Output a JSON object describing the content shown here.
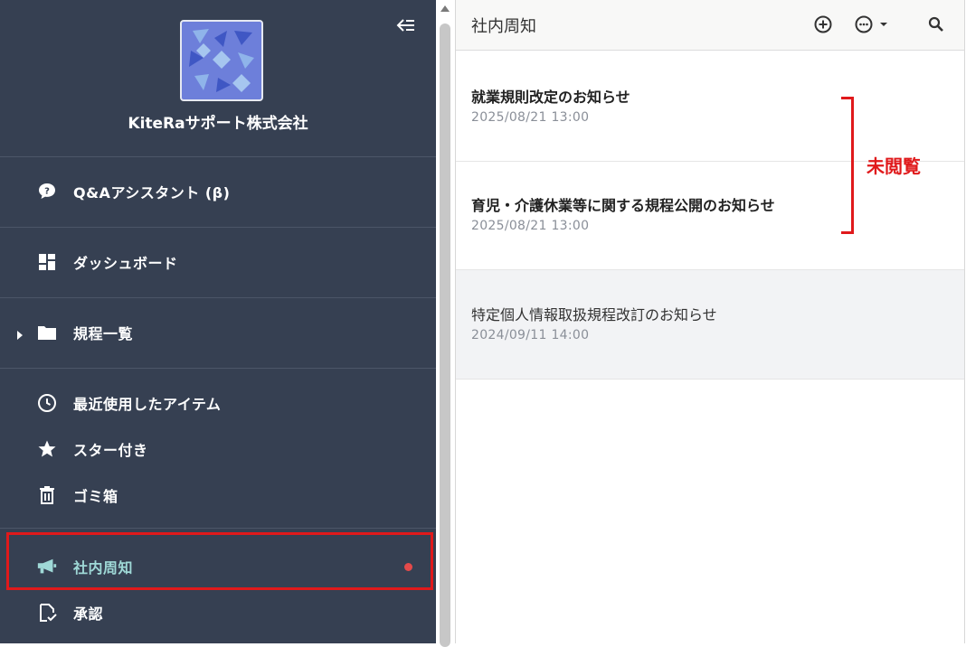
{
  "sidebar": {
    "org_name": "KiteRaサポート株式会社",
    "items": [
      {
        "label": "Q&Aアシスタント (β)",
        "icon": "chat-bubble-icon"
      },
      {
        "label": "ダッシュボード",
        "icon": "dashboard-icon"
      },
      {
        "label": "規程一覧",
        "icon": "folder-icon"
      },
      {
        "label": "最近使用したアイテム",
        "icon": "clock-icon"
      },
      {
        "label": "スター付き",
        "icon": "star-icon"
      },
      {
        "label": "ゴミ箱",
        "icon": "trash-icon"
      },
      {
        "label": "社内周知",
        "icon": "megaphone-icon"
      },
      {
        "label": "承認",
        "icon": "approval-icon"
      }
    ]
  },
  "main": {
    "title": "社内周知",
    "notices": [
      {
        "title": "就業規則改定のお知らせ",
        "date": "2025/08/21 13:00"
      },
      {
        "title": "育児・介護休業等に関する規程公開のお知らせ",
        "date": "2025/08/21 13:00"
      },
      {
        "title": "特定個人情報取扱規程改訂のお知らせ",
        "date": "2024/09/11 14:00"
      }
    ]
  },
  "annotation": {
    "label": "未閲覧"
  },
  "colors": {
    "sidebar_bg": "#364052",
    "active_text": "#9fd9d7",
    "highlight": "#e0191b",
    "unread_dot": "#e44a4a"
  }
}
